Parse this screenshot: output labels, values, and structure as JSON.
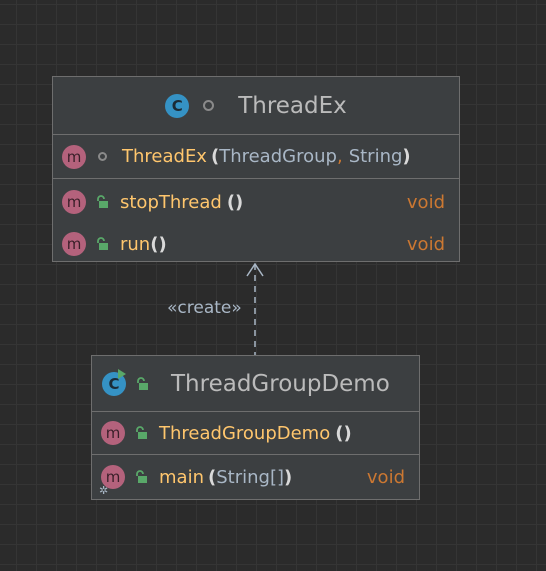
{
  "classes": [
    {
      "name": "ThreadEx",
      "constructor": {
        "name": "ThreadEx",
        "open_paren": "(",
        "param1": "ThreadGroup",
        "comma": ",",
        "param2": "String",
        "close_paren": ")"
      },
      "methods": [
        {
          "name": "stopThread",
          "parens": "()",
          "return_type": "void"
        },
        {
          "name": "run",
          "parens": "()",
          "return_type": "void"
        }
      ]
    },
    {
      "name": "ThreadGroupDemo",
      "constructor": {
        "name": "ThreadGroupDemo",
        "parens": "()"
      },
      "methods": [
        {
          "name": "main",
          "open_paren": "(",
          "param": "String[]",
          "close_paren": ")",
          "return_type": "void"
        }
      ]
    }
  ],
  "relation": {
    "label": "«create»"
  },
  "icons": {
    "class_badge": "C",
    "method_badge": "m"
  },
  "colors": {
    "background": "#2b2b2b",
    "box": "#3c3f41",
    "border": "#6e6e6e",
    "method_name": "#ffc66d",
    "keyword": "#cc7832",
    "class_badge": "#3592c4",
    "method_badge": "#b4627c",
    "public_lock": "#59a869"
  }
}
